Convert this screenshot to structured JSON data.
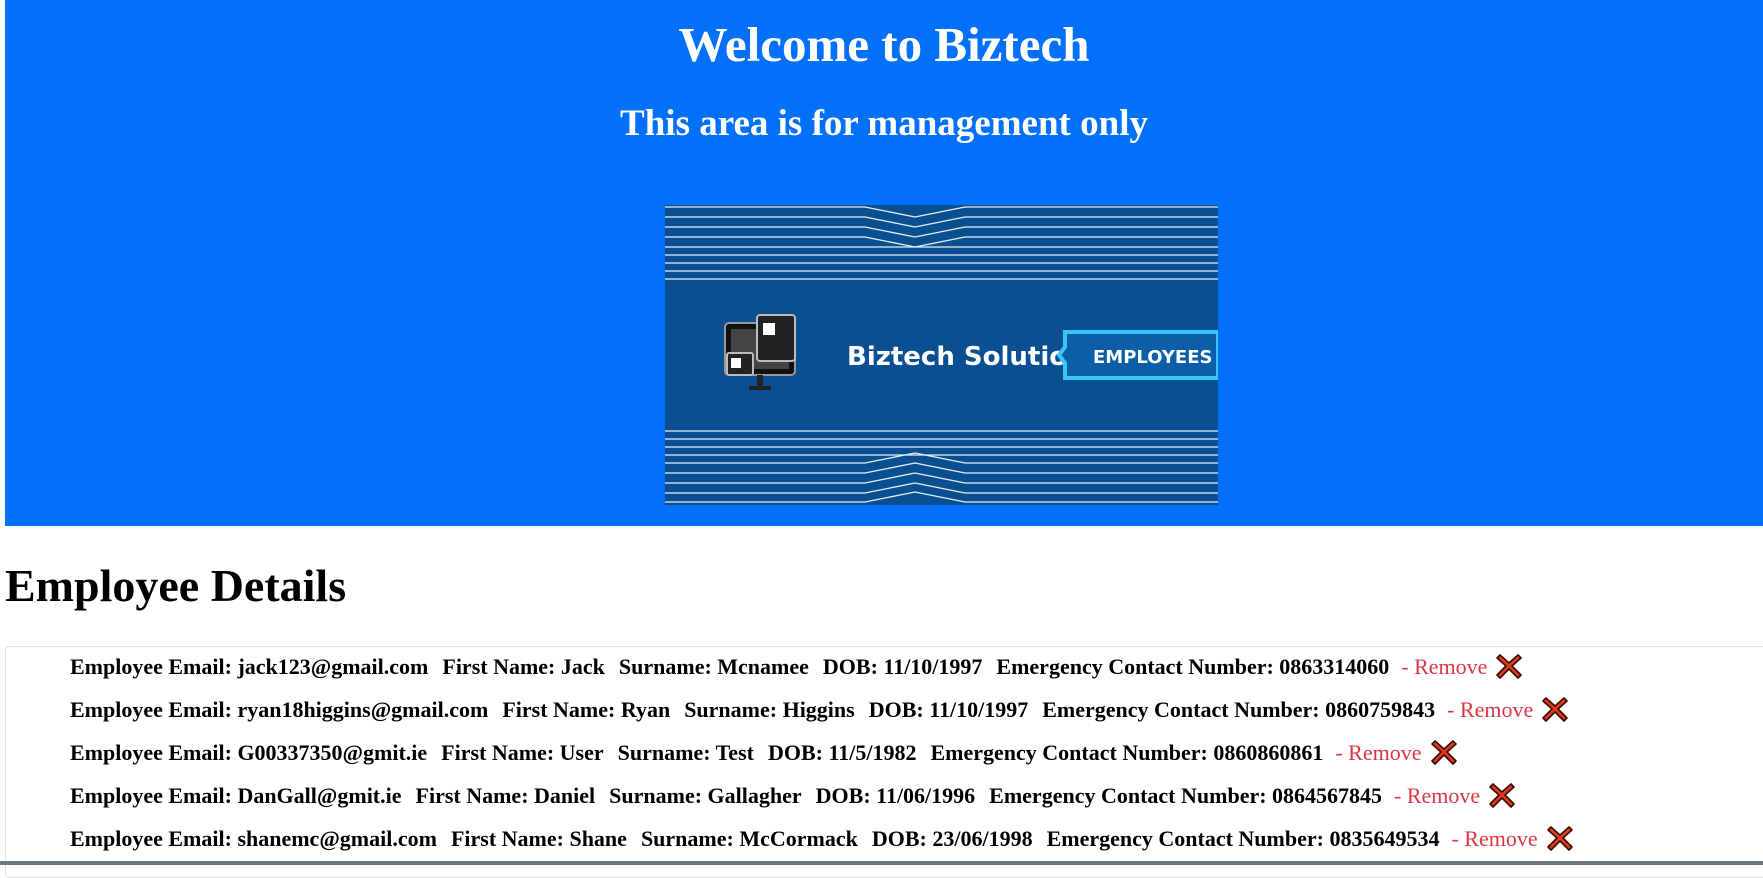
{
  "header": {
    "title": "Welcome to Biztech",
    "subtitle": "This area is for management only",
    "banner": {
      "brand": "Biztech Solutions",
      "tag": "EMPLOYEES"
    }
  },
  "main": {
    "heading": "Employee Details",
    "labels": {
      "email": "Employee Email:",
      "first": "First Name:",
      "surname": "Surname:",
      "dob": "DOB:",
      "phone": "Emergency Contact Number:",
      "remove": "- Remove"
    },
    "employees": [
      {
        "email": "jack123@gmail.com",
        "first": "Jack",
        "surname": "Mcnamee",
        "dob": "11/10/1997",
        "phone": "0863314060"
      },
      {
        "email": "ryan18higgins@gmail.com",
        "first": "Ryan",
        "surname": "Higgins",
        "dob": "11/10/1997",
        "phone": "0860759843"
      },
      {
        "email": "G00337350@gmit.ie",
        "first": "User",
        "surname": "Test",
        "dob": "11/5/1982",
        "phone": "0860860861"
      },
      {
        "email": "DanGall@gmit.ie",
        "first": "Daniel",
        "surname": "Gallagher",
        "dob": "11/06/1996",
        "phone": "0864567845"
      },
      {
        "email": "shanemc@gmail.com",
        "first": "Shane",
        "surname": "McCormack",
        "dob": "23/06/1998",
        "phone": "0835649534"
      }
    ]
  },
  "colors": {
    "header_bg": "#0270f9",
    "remove": "#dc3545",
    "remove_icon": "#e03a1e"
  }
}
